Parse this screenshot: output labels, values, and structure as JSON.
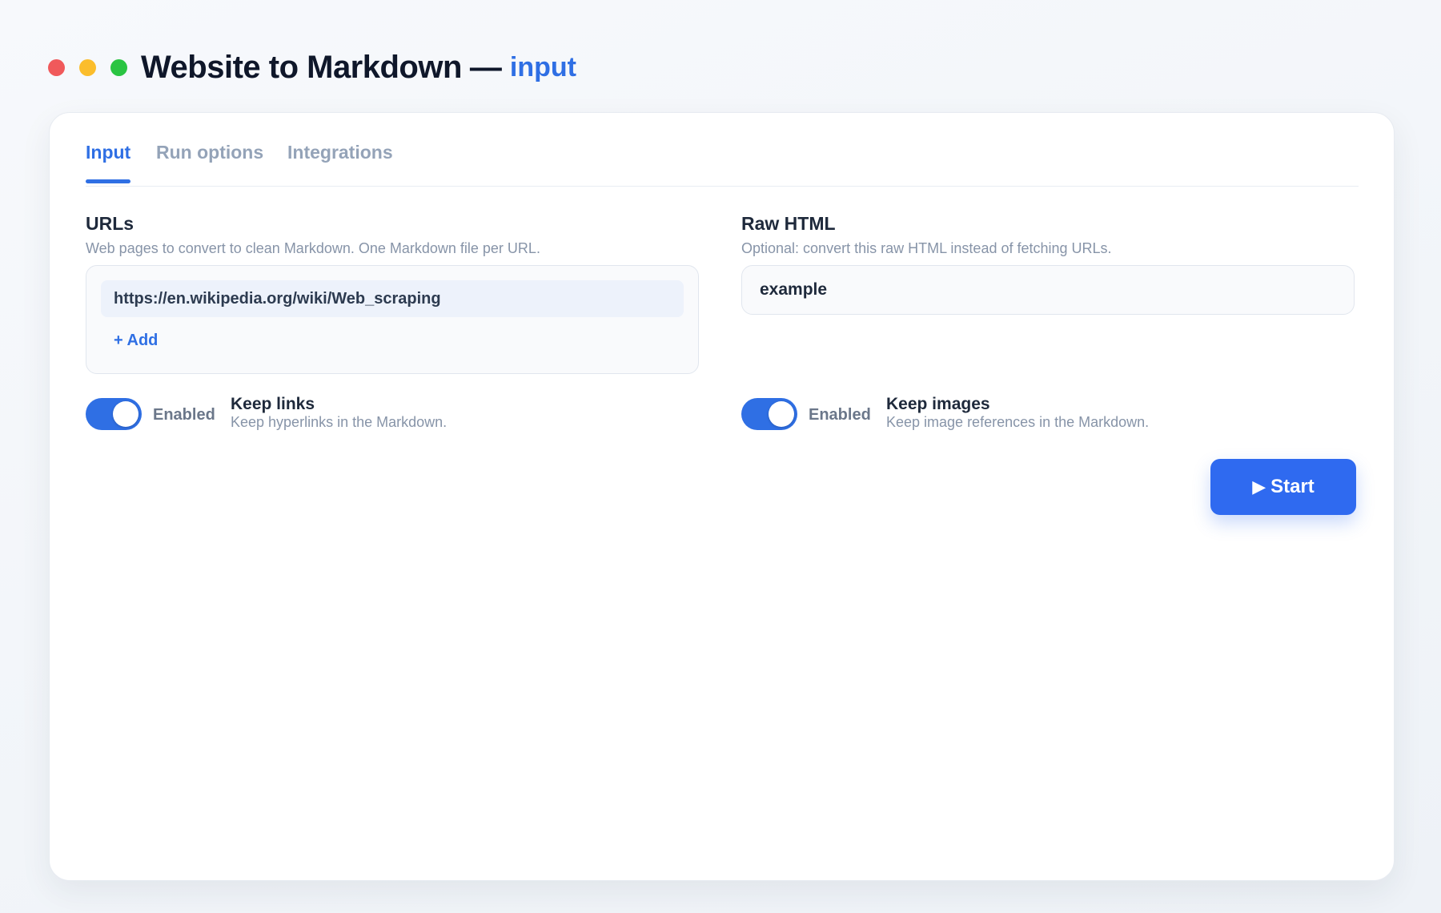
{
  "window": {
    "title": "Website to Markdown",
    "separator": "—",
    "subtitle": "input"
  },
  "tabs": [
    {
      "label": "Input",
      "active": true
    },
    {
      "label": "Run options",
      "active": false
    },
    {
      "label": "Integrations",
      "active": false
    }
  ],
  "urls": {
    "label": "URLs",
    "help": "Web pages to convert to clean Markdown. One Markdown file per URL.",
    "items": [
      "https://en.wikipedia.org/wiki/Web_scraping"
    ],
    "add_label": "+ Add"
  },
  "raw_html": {
    "label": "Raw HTML",
    "help": "Optional: convert this raw HTML instead of fetching URLs.",
    "value": "example"
  },
  "options": [
    {
      "state": "Enabled",
      "enabled": true,
      "title": "Keep links",
      "description": "Keep hyperlinks in the Markdown."
    },
    {
      "state": "Enabled",
      "enabled": true,
      "title": "Keep images",
      "description": "Keep image references in the Markdown."
    }
  ],
  "start_button": {
    "icon": "play-icon",
    "label": "Start"
  },
  "colors": {
    "accent": "#2f6fe4",
    "traffic_red": "#f0595b",
    "traffic_yellow": "#fbbd2c",
    "traffic_green": "#2ac442"
  }
}
